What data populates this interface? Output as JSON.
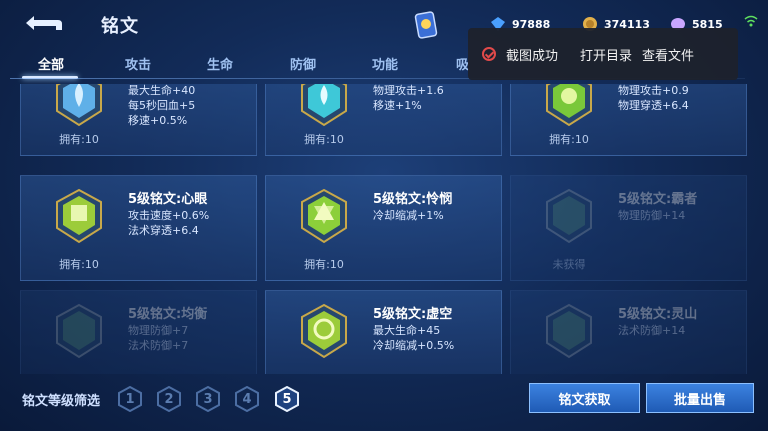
{
  "header": {
    "title": "铭文",
    "currencies": [
      {
        "icon": "gem-icon",
        "value": "97888",
        "color": "#4aa0ff"
      },
      {
        "icon": "gold-coin-icon",
        "value": "374113",
        "color": "#e2b04a"
      },
      {
        "icon": "orb-icon",
        "value": "5815",
        "color": "#c9a6ff"
      }
    ]
  },
  "tabs": [
    "全部",
    "攻击",
    "生命",
    "防御",
    "功能",
    "吸"
  ],
  "toast": {
    "message": "截图成功",
    "actions": [
      "打开目录",
      "查看文件"
    ]
  },
  "cards": [
    {
      "name": "",
      "stats": [
        "最大生命+40",
        "每5秒回血+5",
        "移速+0.5%"
      ],
      "owned": "拥有:10",
      "color": "#5fb0e8",
      "faded": false
    },
    {
      "name": "",
      "stats": [
        "物理攻击+1.6",
        "移速+1%"
      ],
      "owned": "拥有:10",
      "color": "#3ec8d8",
      "faded": false
    },
    {
      "name": "",
      "stats": [
        "物理攻击+0.9",
        "物理穿透+6.4"
      ],
      "owned": "拥有:10",
      "color": "#7ac83a",
      "faded": false
    },
    {
      "name": "5级铭文:心眼",
      "stats": [
        "攻击速度+0.6%",
        "法术穿透+6.4"
      ],
      "owned": "拥有:10",
      "color": "#9ccc3a",
      "faded": false
    },
    {
      "name": "5级铭文:怜悯",
      "stats": [
        "冷却缩减+1%"
      ],
      "owned": "拥有:10",
      "color": "#8ccf3a",
      "faded": false
    },
    {
      "name": "5级铭文:霸者",
      "stats": [
        "物理防御+14"
      ],
      "owned": "未获得",
      "color": "#4f8a7a",
      "faded": true
    },
    {
      "name": "5级铭文:均衡",
      "stats": [
        "物理防御+7",
        "法术防御+7"
      ],
      "owned": "",
      "color": "#4f8a7a",
      "faded": true
    },
    {
      "name": "5级铭文:虚空",
      "stats": [
        "最大生命+45",
        "冷却缩减+0.5%"
      ],
      "owned": "",
      "color": "#9ccc3a",
      "faded": false
    },
    {
      "name": "5级铭文:灵山",
      "stats": [
        "法术防御+14"
      ],
      "owned": "",
      "color": "#4f8a7a",
      "faded": true
    }
  ],
  "filter": {
    "label": "铭文等级筛选",
    "levels": [
      "1",
      "2",
      "3",
      "4",
      "5"
    ],
    "selected": "5"
  },
  "buttons": {
    "obtain": "铭文获取",
    "batch_sell": "批量出售"
  }
}
